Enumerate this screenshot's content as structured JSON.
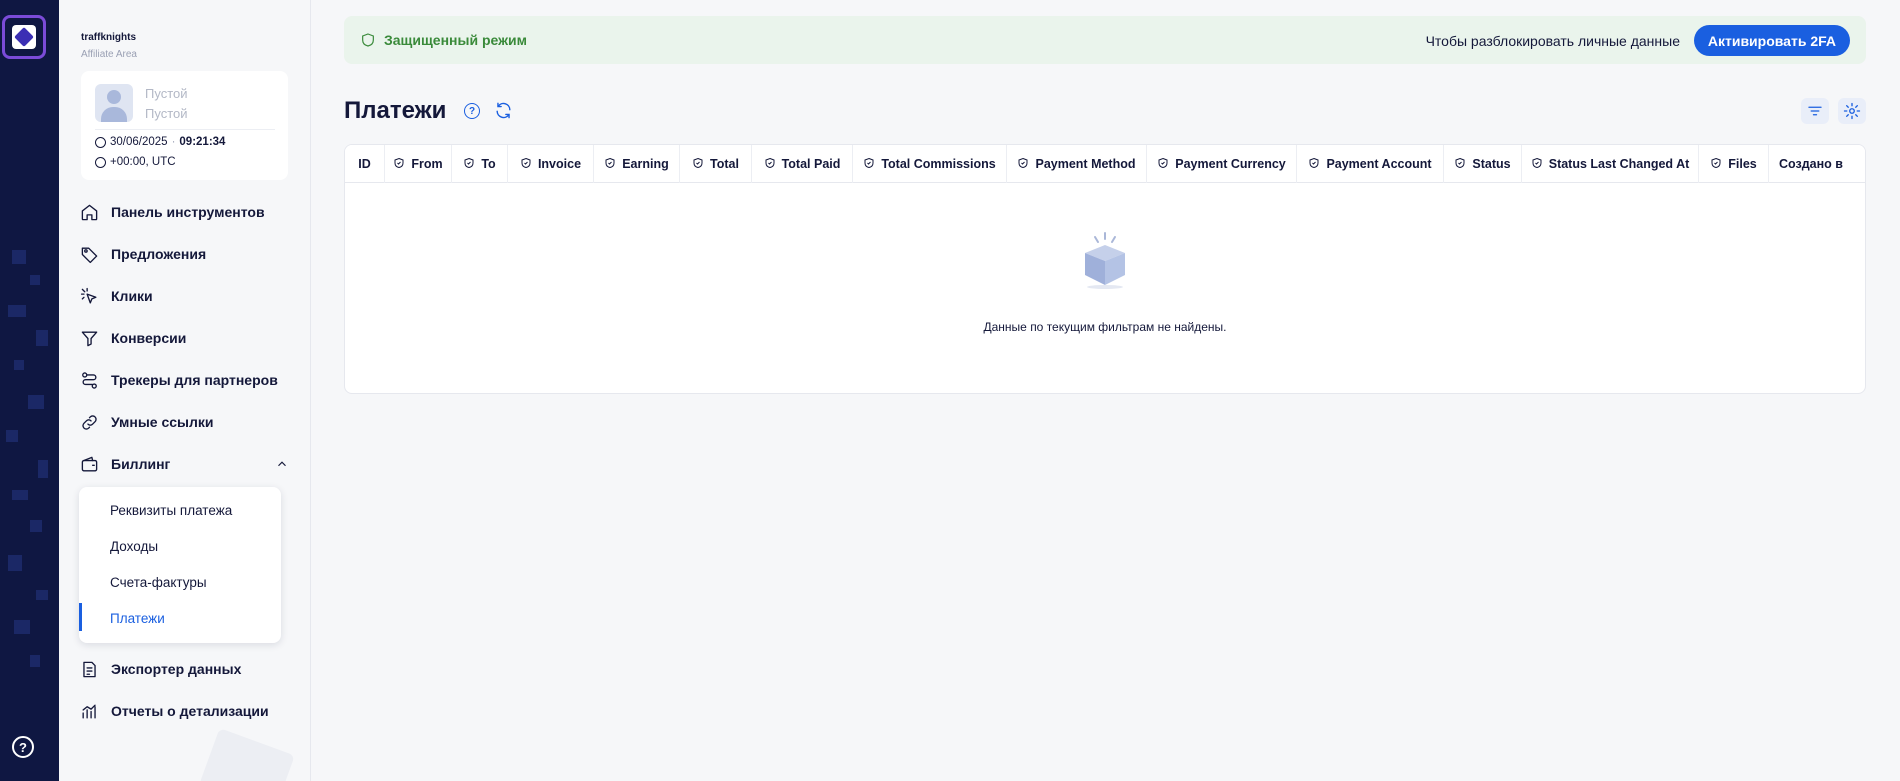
{
  "brand": {
    "name": "traffknights",
    "subtitle": "Affiliate Area"
  },
  "user": {
    "line1": "Пустой",
    "line2": "Пустой",
    "date": "30/06/2025",
    "separator": "·",
    "time": "09:21:34",
    "timezone": "+00:00, UTC"
  },
  "nav": {
    "dashboard": "Панель инструментов",
    "offers": "Предложения",
    "clicks": "Клики",
    "conversions": "Конверсии",
    "trackers": "Трекеры для партнеров",
    "smartlinks": "Умные ссылки",
    "billing": "Биллинг",
    "billing_sub": [
      "Реквизиты платежа",
      "Доходы",
      "Счета-фактуры",
      "Платежи"
    ],
    "exporter": "Экспортер данных",
    "reports": "Отчеты о детализации"
  },
  "banner": {
    "title": "Защищенный режим",
    "text": "Чтобы разблокировать личные данные",
    "button": "Активировать 2FA"
  },
  "page": {
    "title": "Платежи",
    "help": "?"
  },
  "rail": {
    "help": "?"
  },
  "table": {
    "columns": [
      "ID",
      "From",
      "To",
      "Invoice",
      "Earning",
      "Total",
      "Total Paid",
      "Total Commissions",
      "Payment Method",
      "Payment Currency",
      "Payment Account",
      "Status",
      "Status Last Changed At",
      "Files",
      "Создано в"
    ],
    "empty_message": "Данные по текущим фильтрам не найдены."
  },
  "colors": {
    "accent": "#1a5fe0",
    "rail": "#0f1742",
    "banner_bg": "#eaf4ec",
    "banner_text": "#3a8a3a"
  },
  "icons": [
    "home-icon",
    "tag-icon",
    "cursor-click-icon",
    "filter-icon",
    "route-icon",
    "link-icon",
    "wallet-icon",
    "chevron-up-icon",
    "export-icon",
    "chart-icon",
    "shield-icon",
    "refresh-icon",
    "settings-icon",
    "help-icon",
    "box-icon"
  ]
}
